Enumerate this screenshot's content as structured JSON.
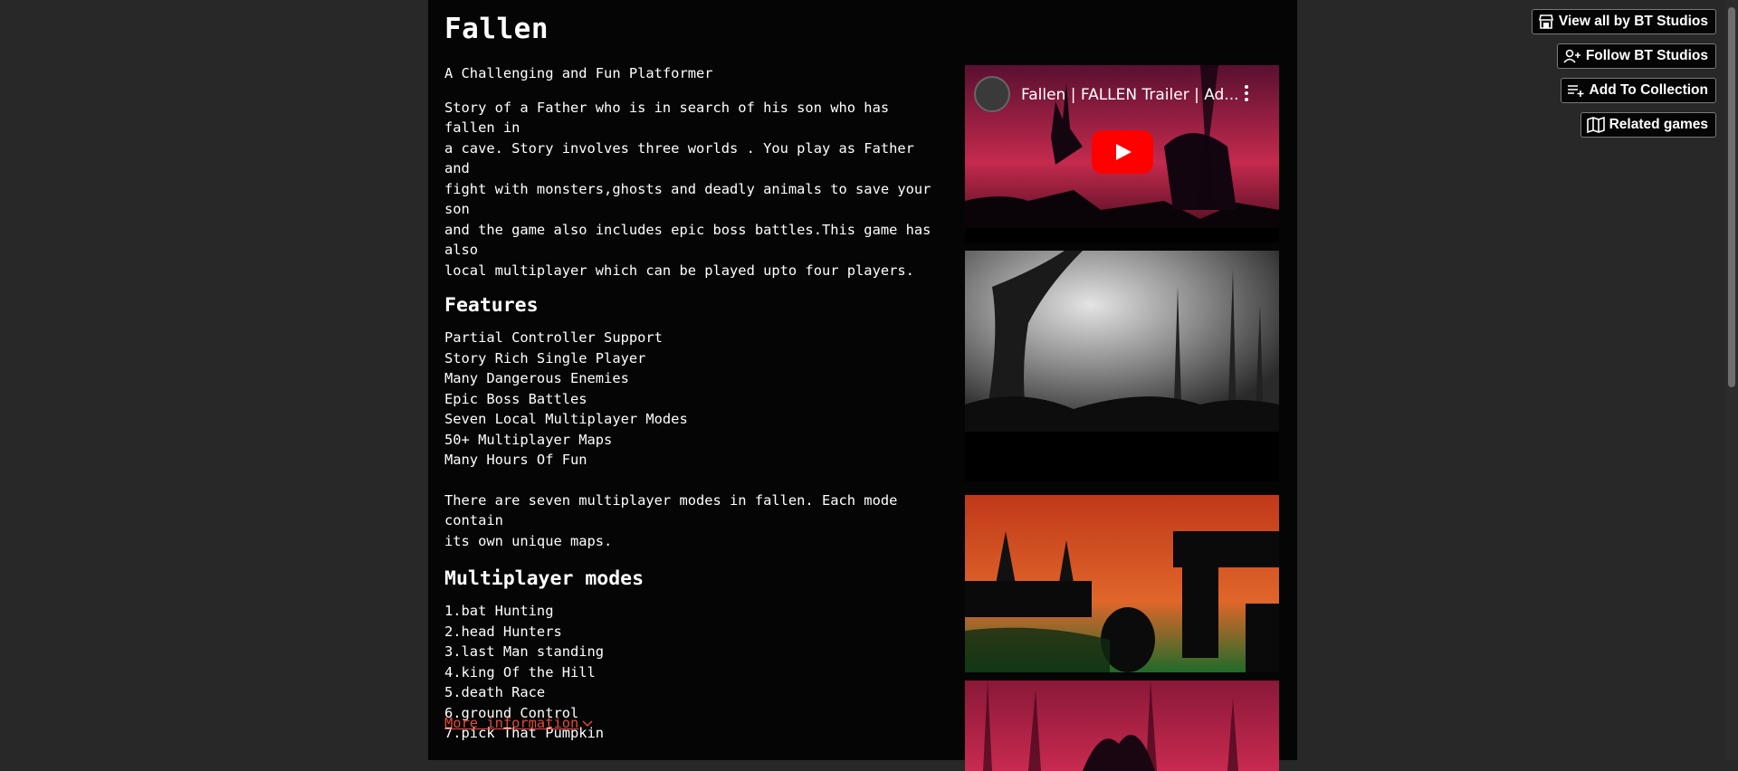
{
  "game": {
    "title": "Fallen",
    "tagline": "A Challenging and Fun Platformer",
    "story": [
      "Story of a Father who is in search of his son who has fallen in",
      "a cave. Story involves three worlds . You play as Father and",
      "fight with monsters,ghosts and deadly animals to save your son",
      "and the game also includes epic boss battles.This game has also",
      "local multiplayer which can be played upto four players."
    ]
  },
  "features": {
    "heading": "Features",
    "items": [
      "Partial Controller Support",
      "Story Rich Single Player",
      "Many Dangerous Enemies",
      "Epic Boss Battles",
      "Seven Local Multiplayer Modes",
      "50+ Multiplayer Maps",
      "Many Hours Of Fun"
    ],
    "note": [
      "There are seven multiplayer modes in fallen. Each mode contain",
      "its own unique maps."
    ]
  },
  "modes": {
    "heading": "Multiplayer modes",
    "items": [
      "1.bat Hunting",
      "2.head Hunters",
      "3.last Man standing",
      "4.king Of the Hill",
      "5.death Race",
      "6.ground Control",
      "7.pick That Pumpkin"
    ]
  },
  "more_info": {
    "label": "More information",
    "icon": "chevron-down-icon"
  },
  "video": {
    "title": "Fallen | FALLEN Trailer | Ad...",
    "icons": [
      "channel-logo-icon",
      "play-icon",
      "more-vertical-icon"
    ]
  },
  "buttons": {
    "view_all": "View all by BT Studios",
    "follow": "Follow BT Studios",
    "add_collection": "Add To Collection",
    "related": "Related games"
  },
  "colors": {
    "page_background": "#282828",
    "column_background": "#050505",
    "link": "#e24a3b",
    "youtube_red": "#ff0000"
  }
}
